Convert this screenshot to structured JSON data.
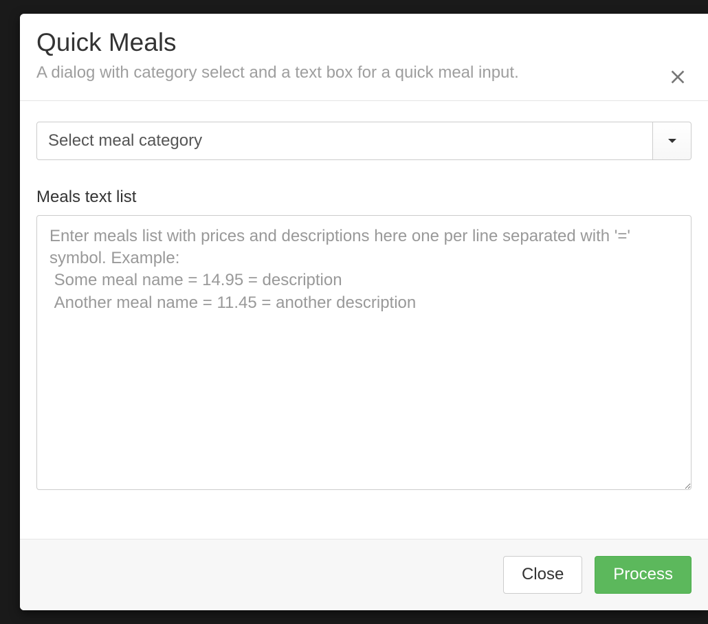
{
  "dialog": {
    "title": "Quick Meals",
    "subtitle": "A dialog with category select and a text box for a quick meal input."
  },
  "form": {
    "category_select": {
      "placeholder": "Select meal category",
      "value": ""
    },
    "meals_text": {
      "label": "Meals text list",
      "placeholder": "Enter meals list with prices and descriptions here one per line separated with '=' symbol. Example:\n Some meal name = 14.95 = description\n Another meal name = 11.45 = another description",
      "value": ""
    }
  },
  "footer": {
    "close_label": "Close",
    "process_label": "Process"
  }
}
